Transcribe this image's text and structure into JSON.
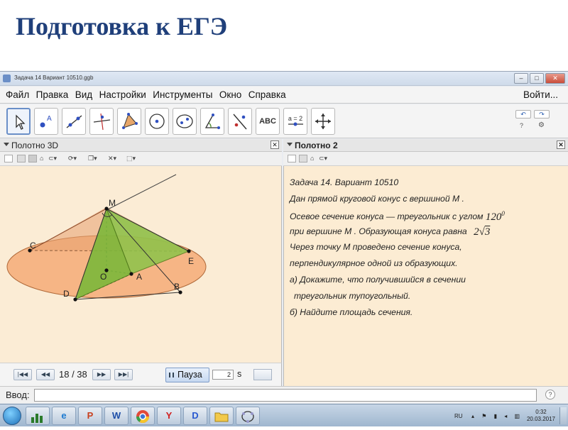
{
  "slide": {
    "title": "Подготовка к ЕГЭ"
  },
  "window": {
    "title": "Задача 14 Вариант 10510.ggb",
    "minimize": "–",
    "maximize": "□",
    "close": "✕"
  },
  "menu": {
    "items": [
      "Файл",
      "Правка",
      "Вид",
      "Настройки",
      "Инструменты",
      "Окно",
      "Справка"
    ],
    "login": "Войти..."
  },
  "toolbar": {
    "tools": [
      "move-tool-icon",
      "point-tool-icon",
      "line-tool-icon",
      "perpendicular-line-tool-icon",
      "polygon-tool-icon",
      "circle-tool-icon",
      "ellipse-tool-icon",
      "angle-tool-icon",
      "reflect-tool-icon",
      "text-tool-icon",
      "slider-tool-icon",
      "move-view-tool-icon"
    ],
    "text_tool_label": "ABC",
    "slider_tool_label": "a = 2"
  },
  "panel3d": {
    "title": "Полотно 3D",
    "points": {
      "M": "M",
      "C": "C",
      "O": "O",
      "A": "A",
      "D": "D",
      "B": "B",
      "E": "E"
    }
  },
  "panel2": {
    "title": "Полотно 2",
    "lines": {
      "l1": "Задача 14. Вариант 10510",
      "l2": "Дан прямой круговой конус с вершиной M .",
      "l3": "Осевое сечение конуса — треугольник с углом",
      "l3_math": "120",
      "l3_sup": "0",
      "l4": "при вершине M . Образующая конуса равна",
      "l4_math_coef": "2",
      "l4_math_rad": "3",
      "l5": "Через точку M проведено сечение конуса,",
      "l6": "перпендикулярное одной из образующих.",
      "l7": "а) Докажите, что получившийся в сечении",
      "l8": "треугольник тупоугольный.",
      "l9": "б) Найдите площадь сечения."
    }
  },
  "animation": {
    "frame_counter": "18 / 38",
    "pause_label": "Пауза",
    "speed_value": "2",
    "speed_unit": "s"
  },
  "input_bar": {
    "label": "Ввод:",
    "value": "",
    "help": "?"
  },
  "taskbar": {
    "apps": [
      "windows-start-icon",
      "chart-app-icon",
      "internet-explorer-icon",
      "powerpoint-icon",
      "word-icon",
      "chrome-icon",
      "yandex-browser-icon",
      "video-player-icon",
      "folder-icon",
      "geogebra-icon"
    ],
    "apps_letters": [
      "",
      "",
      "e",
      "P",
      "W",
      "",
      "Y",
      "D",
      "",
      ""
    ],
    "language": "RU",
    "time": "0:32",
    "date": "20.03.2017"
  }
}
